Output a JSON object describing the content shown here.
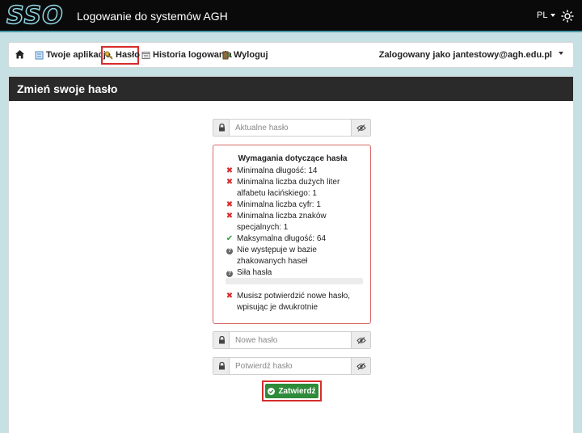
{
  "header": {
    "logo": "SSO",
    "app_title": "Logowanie do systemów AGH",
    "language": "PL"
  },
  "nav": {
    "items": [
      {
        "label": "Twoje aplikacje",
        "icon": "apps-icon"
      },
      {
        "label": "Hasło",
        "icon": "key-icon"
      },
      {
        "label": "Historia logowania",
        "icon": "history-icon"
      },
      {
        "label": "Wyloguj",
        "icon": "logout-icon"
      }
    ],
    "active": "Hasło",
    "user_label": "Zalogowany jako jantestowy@agh.edu.pl"
  },
  "panel": {
    "title": "Zmień swoje hasło"
  },
  "form": {
    "current_password_placeholder": "Aktualne hasło",
    "new_password_placeholder": "Nowe hasło",
    "confirm_password_placeholder": "Potwierdź hasło",
    "submit_label": "Zatwierdź"
  },
  "requirements": {
    "title": "Wymagania dotyczące hasła",
    "items": [
      {
        "status": "fail",
        "text": "Minimalna długość: 14"
      },
      {
        "status": "fail",
        "text": "Minimalna liczba dużych liter alfabetu łacińskiego: 1"
      },
      {
        "status": "fail",
        "text": "Minimalna liczba cyfr: 1"
      },
      {
        "status": "fail",
        "text": "Minimalna liczba znaków specjalnych: 1"
      },
      {
        "status": "ok",
        "text": "Maksymalna długość: 64"
      },
      {
        "status": "unknown",
        "text": "Nie występuje w bazie zhakowanych haseł"
      },
      {
        "status": "unknown",
        "text": "Siła hasła"
      },
      {
        "status": "fail",
        "text": "Musisz potwierdzić nowe hasło, wpisując je dwukrotnie"
      }
    ],
    "strength_level": 0
  }
}
